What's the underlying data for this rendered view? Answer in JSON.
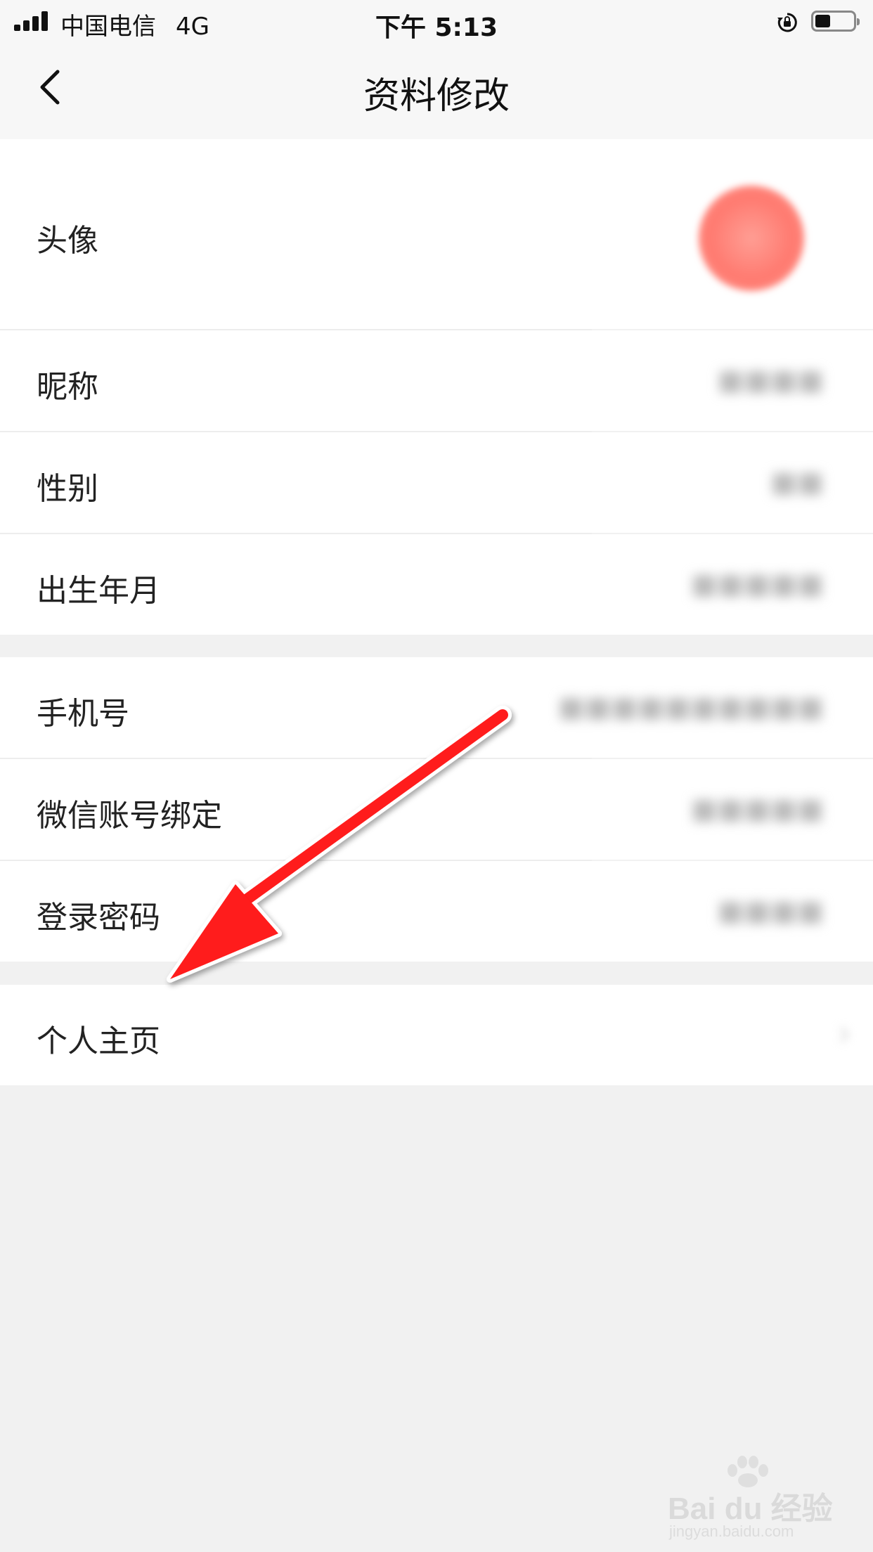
{
  "status_bar": {
    "carrier": "中国电信",
    "network": "4G",
    "time": "下午 5:13"
  },
  "header": {
    "title": "资料修改",
    "back_icon": "chevron-left-icon"
  },
  "rows": [
    {
      "label": "头像",
      "value": ""
    },
    {
      "label": "昵称",
      "value": "■■■■"
    },
    {
      "label": "性别",
      "value": "■■"
    },
    {
      "label": "出生年月",
      "value": "■■■■■"
    },
    {
      "label": "手机号",
      "value": "■■■■■■■■■■"
    },
    {
      "label": "微信账号绑定",
      "value": "■■■■■"
    },
    {
      "label": "登录密码",
      "value": "■■■■"
    },
    {
      "label": "个人主页",
      "value": ""
    }
  ],
  "watermark": {
    "brand": "Bai du 经验",
    "url": "jingyan.baidu.com"
  },
  "colors": {
    "annotation_arrow": "#ff1a1a",
    "background": "#f1f1f1",
    "avatar": "#ff7a70"
  },
  "battery_level_fraction": 0.4
}
